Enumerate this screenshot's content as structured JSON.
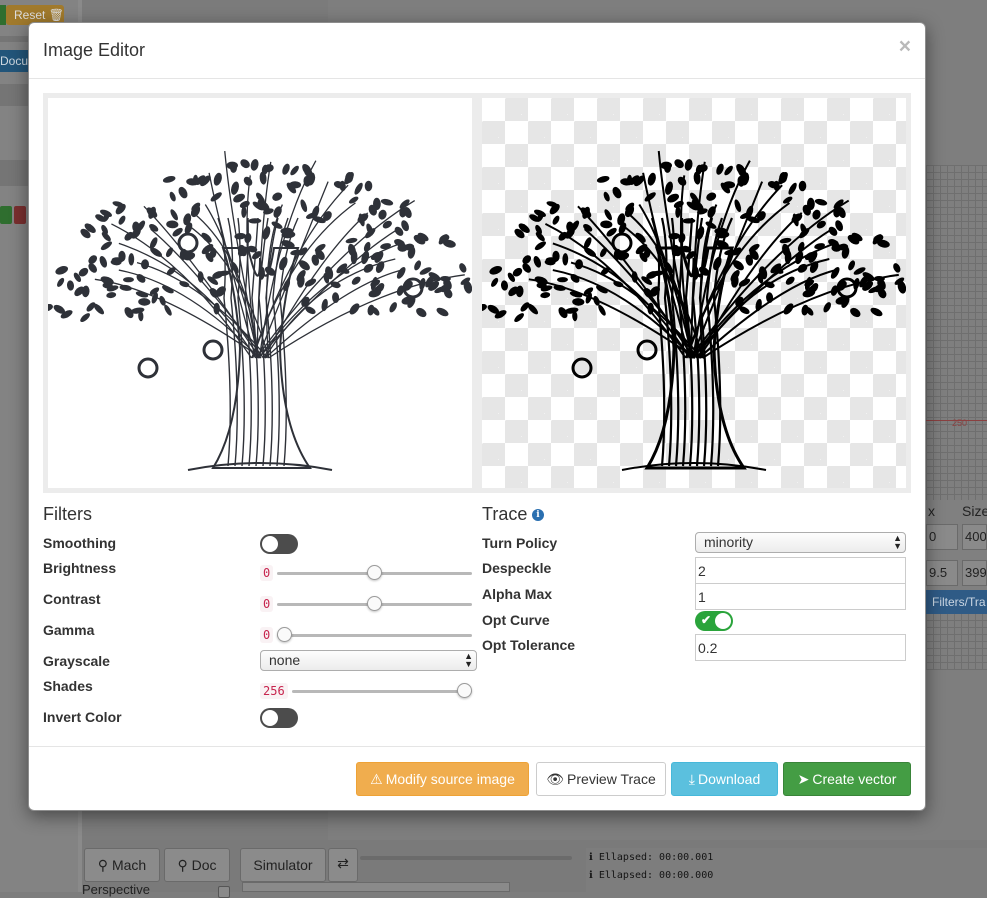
{
  "background": {
    "reset_label": "Reset",
    "docu_label": "Docu",
    "grid_label": "250",
    "table_headers": [
      "x",
      "Size"
    ],
    "table_row1": [
      "0",
      "400"
    ],
    "table_row2": [
      "9.5",
      "399"
    ],
    "filters_button": "Filters/Tra",
    "mach_label": "Mach",
    "doc_label": "Doc",
    "simulator_label": "Simulator",
    "console_lines": [
      "Ellapsed: 00:00.001",
      "Ellapsed: 00:00.000"
    ],
    "perspective_label": "Perspective"
  },
  "modal": {
    "title": "Image Editor",
    "close_glyph": "×"
  },
  "filters": {
    "title": "Filters",
    "smoothing_label": "Smoothing",
    "smoothing_on": false,
    "brightness_label": "Brightness",
    "brightness_value": "0",
    "brightness_fraction": 0.5,
    "contrast_label": "Contrast",
    "contrast_value": "0",
    "contrast_fraction": 0.5,
    "gamma_label": "Gamma",
    "gamma_value": "0",
    "gamma_fraction": 0.0,
    "grayscale_label": "Grayscale",
    "grayscale_value": "none",
    "shades_label": "Shades",
    "shades_value": "256",
    "shades_fraction": 1.0,
    "invert_label": "Invert Color",
    "invert_on": false
  },
  "trace": {
    "title": "Trace",
    "turn_policy_label": "Turn Policy",
    "turn_policy_value": "minority",
    "despeckle_label": "Despeckle",
    "despeckle_value": "2",
    "alpha_max_label": "Alpha Max",
    "alpha_max_value": "1",
    "opt_curve_label": "Opt Curve",
    "opt_curve_on": true,
    "opt_tolerance_label": "Opt Tolerance",
    "opt_tolerance_value": "0.2"
  },
  "footer": {
    "modify_label": "Modify source image",
    "preview_label": "Preview Trace",
    "download_label": "Download",
    "create_label": "Create vector"
  },
  "colors": {
    "warning": "#f0ad4e",
    "info": "#5bc0de",
    "success": "#449d44",
    "toggle_on": "#2aa43b",
    "toggle_off": "#4c4c4c"
  }
}
